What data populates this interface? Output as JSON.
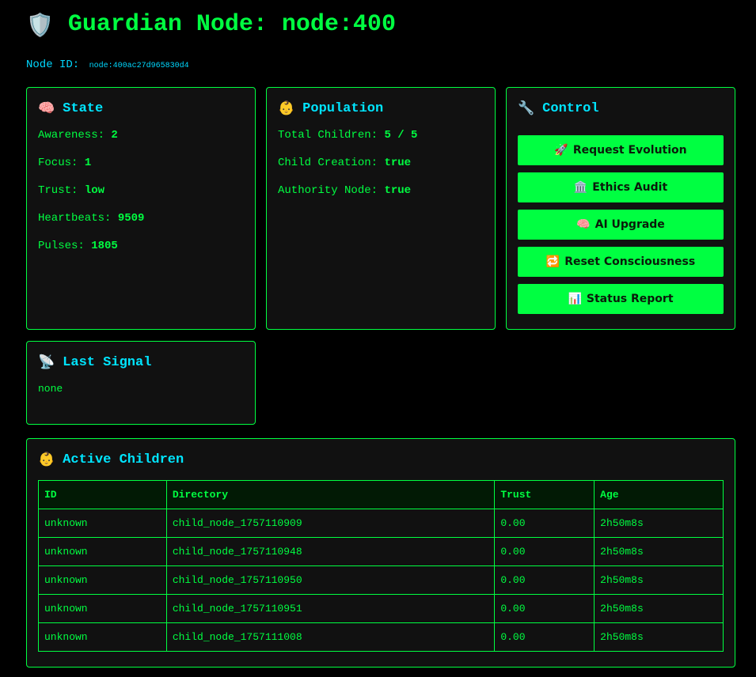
{
  "header": {
    "icon": "shield-icon",
    "title": "Guardian Node: node:400"
  },
  "node_id": {
    "label": "Node ID:",
    "value": "node:400ac27d965830d4"
  },
  "state": {
    "icon": "brain-icon",
    "title": "State",
    "rows": [
      {
        "label": "Awareness:",
        "value": "2"
      },
      {
        "label": "Focus:",
        "value": "1"
      },
      {
        "label": "Trust:",
        "value": "low"
      },
      {
        "label": "Heartbeats:",
        "value": "9509"
      },
      {
        "label": "Pulses:",
        "value": "1805"
      }
    ]
  },
  "population": {
    "icon": "baby-icon",
    "title": "Population",
    "rows": [
      {
        "label": "Total Children:",
        "value": "5 / 5"
      },
      {
        "label": "Child Creation:",
        "value": "true"
      },
      {
        "label": "Authority Node:",
        "value": "true"
      }
    ]
  },
  "control": {
    "icon": "wrench-icon",
    "title": "Control",
    "buttons": [
      {
        "icon": "rocket-icon",
        "label": "Request Evolution"
      },
      {
        "icon": "classical-building-icon",
        "label": "Ethics Audit"
      },
      {
        "icon": "brain-icon",
        "label": "AI Upgrade"
      },
      {
        "icon": "repeat-icon",
        "label": "Reset Consciousness"
      },
      {
        "icon": "bar-chart-icon",
        "label": "Status Report"
      }
    ]
  },
  "last_signal": {
    "icon": "satellite-antenna-icon",
    "title": "Last Signal",
    "value": "none"
  },
  "children": {
    "icon": "baby-icon",
    "title": "Active Children",
    "columns": [
      "ID",
      "Directory",
      "Trust",
      "Age"
    ],
    "rows": [
      [
        "unknown",
        "child_node_1757110909",
        "0.00",
        "2h50m8s"
      ],
      [
        "unknown",
        "child_node_1757110948",
        "0.00",
        "2h50m8s"
      ],
      [
        "unknown",
        "child_node_1757110950",
        "0.00",
        "2h50m8s"
      ],
      [
        "unknown",
        "child_node_1757110951",
        "0.00",
        "2h50m8s"
      ],
      [
        "unknown",
        "child_node_1757111008",
        "0.00",
        "2h50m8s"
      ]
    ]
  },
  "colors": {
    "accent": "#00ff41",
    "heading": "#00e5ff",
    "panel_bg": "#111111",
    "page_bg": "#000000"
  }
}
